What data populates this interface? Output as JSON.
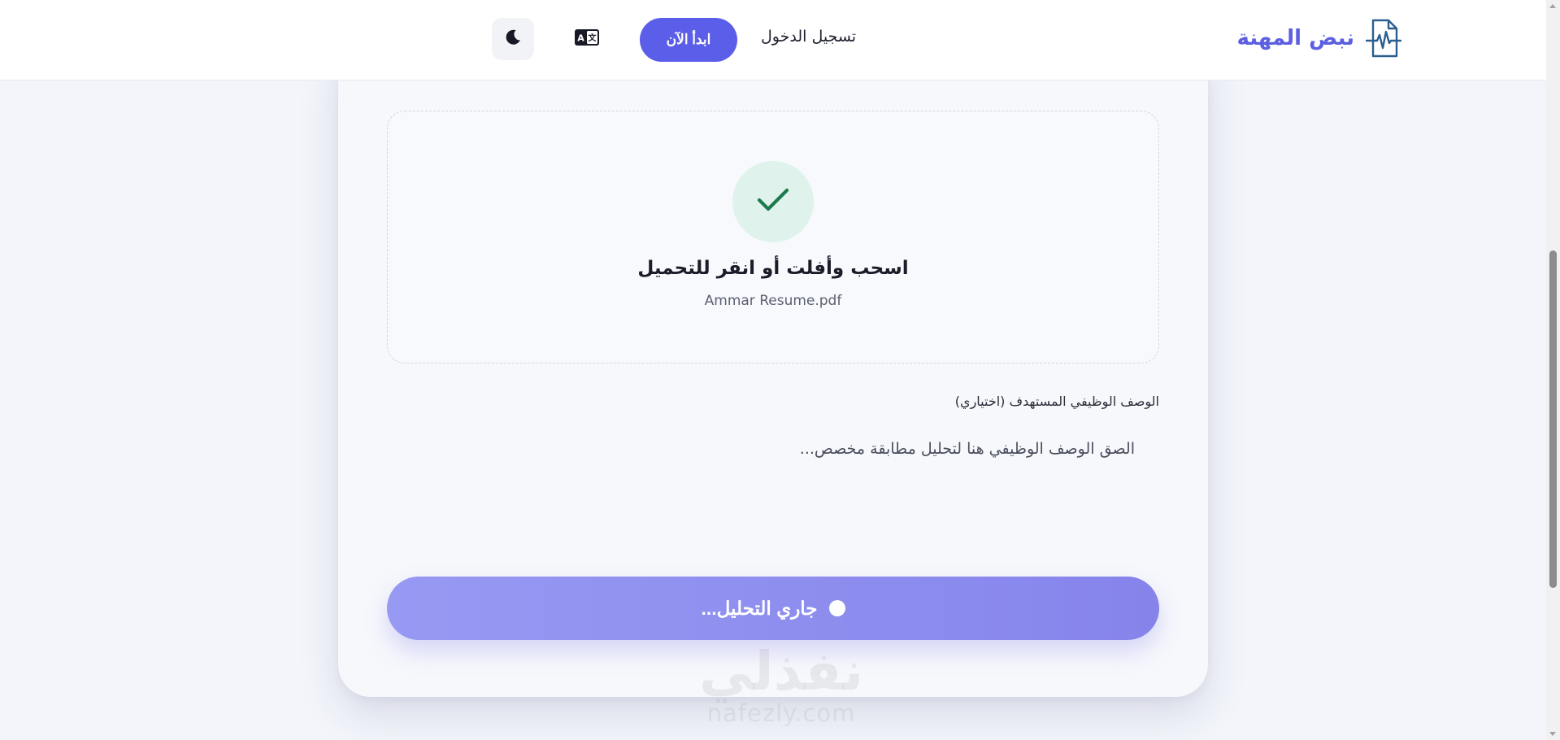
{
  "header": {
    "brand_name": "نبض المهنة",
    "login_label": "تسجيل الدخول",
    "start_label": "ابدأ الآن",
    "accent_color": "#5b5ee8",
    "icons": {
      "brand": "heartbeat-document-icon",
      "language": "translate-icon",
      "theme": "moon-icon"
    }
  },
  "upload": {
    "status_icon": "check-icon",
    "title": "اسحب وأفلت أو انقر للتحميل",
    "file_name": "Ammar Resume.pdf"
  },
  "job_description": {
    "label": "الوصف الوظيفي المستهدف (اختياري)",
    "placeholder": "الصق الوصف الوظيفي هنا لتحليل مطابقة مخصص..."
  },
  "analyze_button": {
    "label": "جاري التحليل...",
    "loading": true
  },
  "watermark": {
    "arabic": "نفذلي",
    "latin": "nafezly.com"
  }
}
